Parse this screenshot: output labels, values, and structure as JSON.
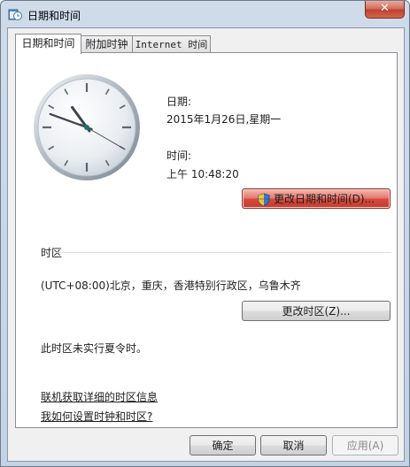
{
  "window": {
    "title": "日期和时间",
    "close_glyph": "✕"
  },
  "tabs": [
    {
      "label": "日期和时间",
      "active": true
    },
    {
      "label": "附加时钟",
      "active": false
    },
    {
      "label": "Internet 时间",
      "active": false
    }
  ],
  "datetime": {
    "date_label": "日期:",
    "date_value": "2015年1月26日,星期一",
    "time_label": "时间:",
    "time_value": "上午 10:48:20",
    "change_datetime_button": "更改日期和时间(D)..."
  },
  "timezone": {
    "section_label": "时区",
    "value": "(UTC+08:00)北京，重庆，香港特别行政区，乌鲁木齐",
    "change_timezone_button": "更改时区(Z)...",
    "dst_note": "此时区未实行夏令时。"
  },
  "links": {
    "online_info": "联机获取详细的时区信息",
    "how_to": "我如何设置时钟和时区?"
  },
  "footer": {
    "ok": "确定",
    "cancel": "取消",
    "apply": "应用(A)"
  },
  "clock": {
    "hours": 10,
    "minutes": 48,
    "seconds": 20
  }
}
